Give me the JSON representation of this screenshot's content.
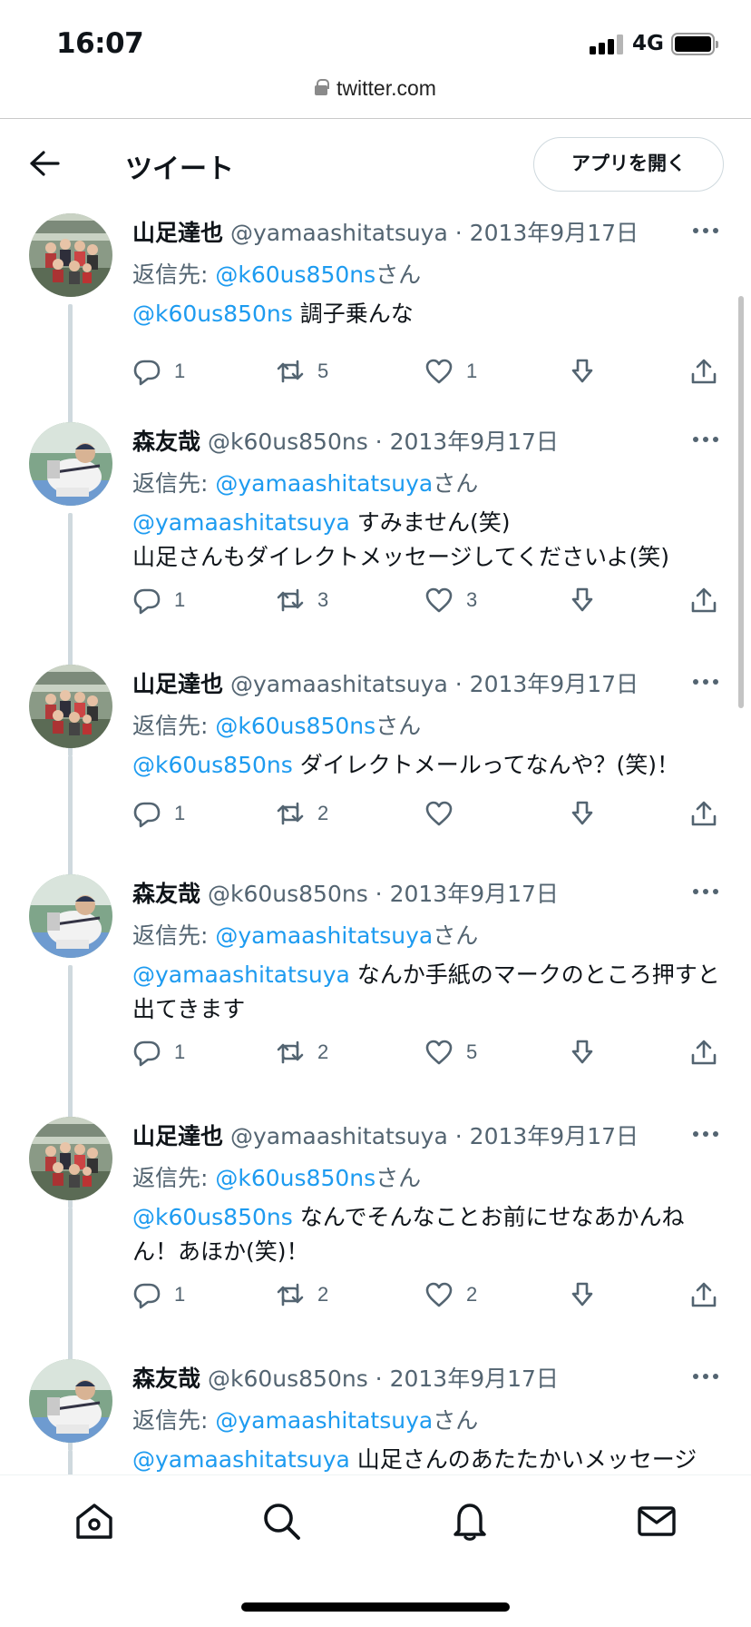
{
  "status_bar": {
    "time": "16:07",
    "network": "4G"
  },
  "browser": {
    "url": "twitter.com"
  },
  "header": {
    "title": "ツイート",
    "open_app_label": "アプリを開く"
  },
  "tweets": [
    {
      "name": "山足達也",
      "handle": "@yamaashitatsuya",
      "date": "· 2013年9月17日",
      "reply_prefix": "返信先: ",
      "reply_to": "@k60us850ns",
      "reply_suffix": "さん",
      "mention": "@k60us850ns",
      "text": " 調子乗んな",
      "replies": "1",
      "retweets": "5",
      "likes": "1",
      "liked": false,
      "avatar": "group-photo"
    },
    {
      "name": "森友哉",
      "handle": "@k60us850ns",
      "date": "· 2013年9月17日",
      "reply_prefix": "返信先: ",
      "reply_to": "@yamaashitatsuya",
      "reply_suffix": "さん",
      "mention": "@yamaashitatsuya",
      "text": " すみません(笑)\n山足さんもダイレクトメッセージしてくださいよ(笑)",
      "replies": "1",
      "retweets": "3",
      "likes": "3",
      "liked": false,
      "avatar": "baseball-player"
    },
    {
      "name": "山足達也",
      "handle": "@yamaashitatsuya",
      "date": "· 2013年9月17日",
      "reply_prefix": "返信先: ",
      "reply_to": "@k60us850ns",
      "reply_suffix": "さん",
      "mention": "@k60us850ns",
      "text": " ダイレクトメールってなんや？(笑)！",
      "replies": "1",
      "retweets": "2",
      "likes": "",
      "liked": false,
      "avatar": "group-photo"
    },
    {
      "name": "森友哉",
      "handle": "@k60us850ns",
      "date": "· 2013年9月17日",
      "reply_prefix": "返信先: ",
      "reply_to": "@yamaashitatsuya",
      "reply_suffix": "さん",
      "mention": "@yamaashitatsuya",
      "text": " なんか手紙のマークのところ押すと出てきます",
      "replies": "1",
      "retweets": "2",
      "likes": "5",
      "liked": false,
      "avatar": "baseball-player"
    },
    {
      "name": "山足達也",
      "handle": "@yamaashitatsuya",
      "date": "· 2013年9月17日",
      "reply_prefix": "返信先: ",
      "reply_to": "@k60us850ns",
      "reply_suffix": "さん",
      "mention": "@k60us850ns",
      "text": " なんでそんなことお前にせなあかんねん！あほか(笑)！",
      "replies": "1",
      "retweets": "2",
      "likes": "2",
      "liked": false,
      "avatar": "group-photo"
    },
    {
      "name": "森友哉",
      "handle": "@k60us850ns",
      "date": "· 2013年9月17日",
      "reply_prefix": "返信先: ",
      "reply_to": "@yamaashitatsuya",
      "reply_suffix": "さん",
      "mention": "@yamaashitatsuya",
      "text": " 山足さんのあたたかいメッセージ",
      "replies": "",
      "retweets": "",
      "likes": "",
      "liked": false,
      "avatar": "baseball-player"
    }
  ],
  "bottom_nav": [
    {
      "id": "home",
      "icon": "home-icon"
    },
    {
      "id": "search",
      "icon": "search-icon"
    },
    {
      "id": "notifications",
      "icon": "bell-icon"
    },
    {
      "id": "messages",
      "icon": "mail-icon"
    }
  ],
  "colors": {
    "link": "#1d9bf0",
    "secondary_text": "#536471",
    "thread_line": "#cfd9de"
  }
}
